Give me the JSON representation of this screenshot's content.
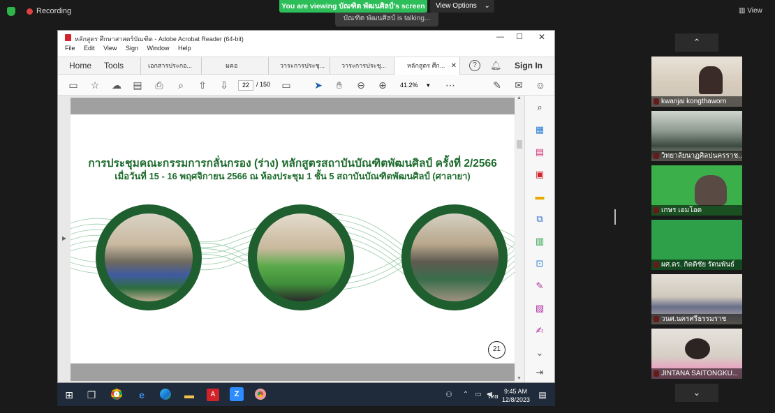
{
  "zoom_meeting": {
    "recording_label": "Recording",
    "viewing_banner": "You are viewing บัณฑิต พัฒนศิลป์'s screen",
    "talking_label": "บัณฑิต พัฒนศิลป์ is talking...",
    "view_options": "View Options",
    "view_button": "View",
    "colors": {
      "banner": "#2dbe5a",
      "record": "#e04040",
      "mic_muted": "#e23d3d"
    }
  },
  "acrobat": {
    "window_title": "หลักสูตร ศึกษาสาสตร์บัณฑิต - Adobe Acrobat Reader (64-bit)",
    "menu": [
      "File",
      "Edit",
      "View",
      "Sign",
      "Window",
      "Help"
    ],
    "nav": {
      "home": "Home",
      "tools": "Tools"
    },
    "tabs": [
      "เอกสารประกอ...",
      "มคอ",
      "วาระการประชุ...",
      "วาระการประชุ...",
      "หลักสูตร ศึก..."
    ],
    "sign_in": "Sign In",
    "page_current": "22",
    "page_total": "/ 150",
    "zoom": "41.2%",
    "slide": {
      "title_line1": "การประชุมคณะกรรมการกลั่นกรอง (ร่าง) หลักสูตรสถาบันบัณฑิตพัฒนศิลป์ ครั้งที่ 2/2566",
      "title_line2": "เมื่อวันที่ 15 - 16 พฤศจิกายน 2566 ณ ห้องประชุม 1 ชั้น 5 สถาบันบัณฑิตพัฒนศิลป์ (ศาลายา)",
      "page_number": "21",
      "accent": "#1e6b2d"
    }
  },
  "taskbar": {
    "time": "9:45 AM",
    "date": "12/8/2023",
    "lang": "ไทย"
  },
  "participants": [
    {
      "name": "kwanjai kongthaworn"
    },
    {
      "name": "วิทยาลัยนาฏศิลปนครราช..."
    },
    {
      "name": "เกษร เอมโอด"
    },
    {
      "name": "ผศ.ดร. กิตติชัย รัตนพันธ์"
    },
    {
      "name": "วนศ.นครศรีธรรมราช"
    },
    {
      "name": "JINTANA SAITONGKU..."
    }
  ]
}
